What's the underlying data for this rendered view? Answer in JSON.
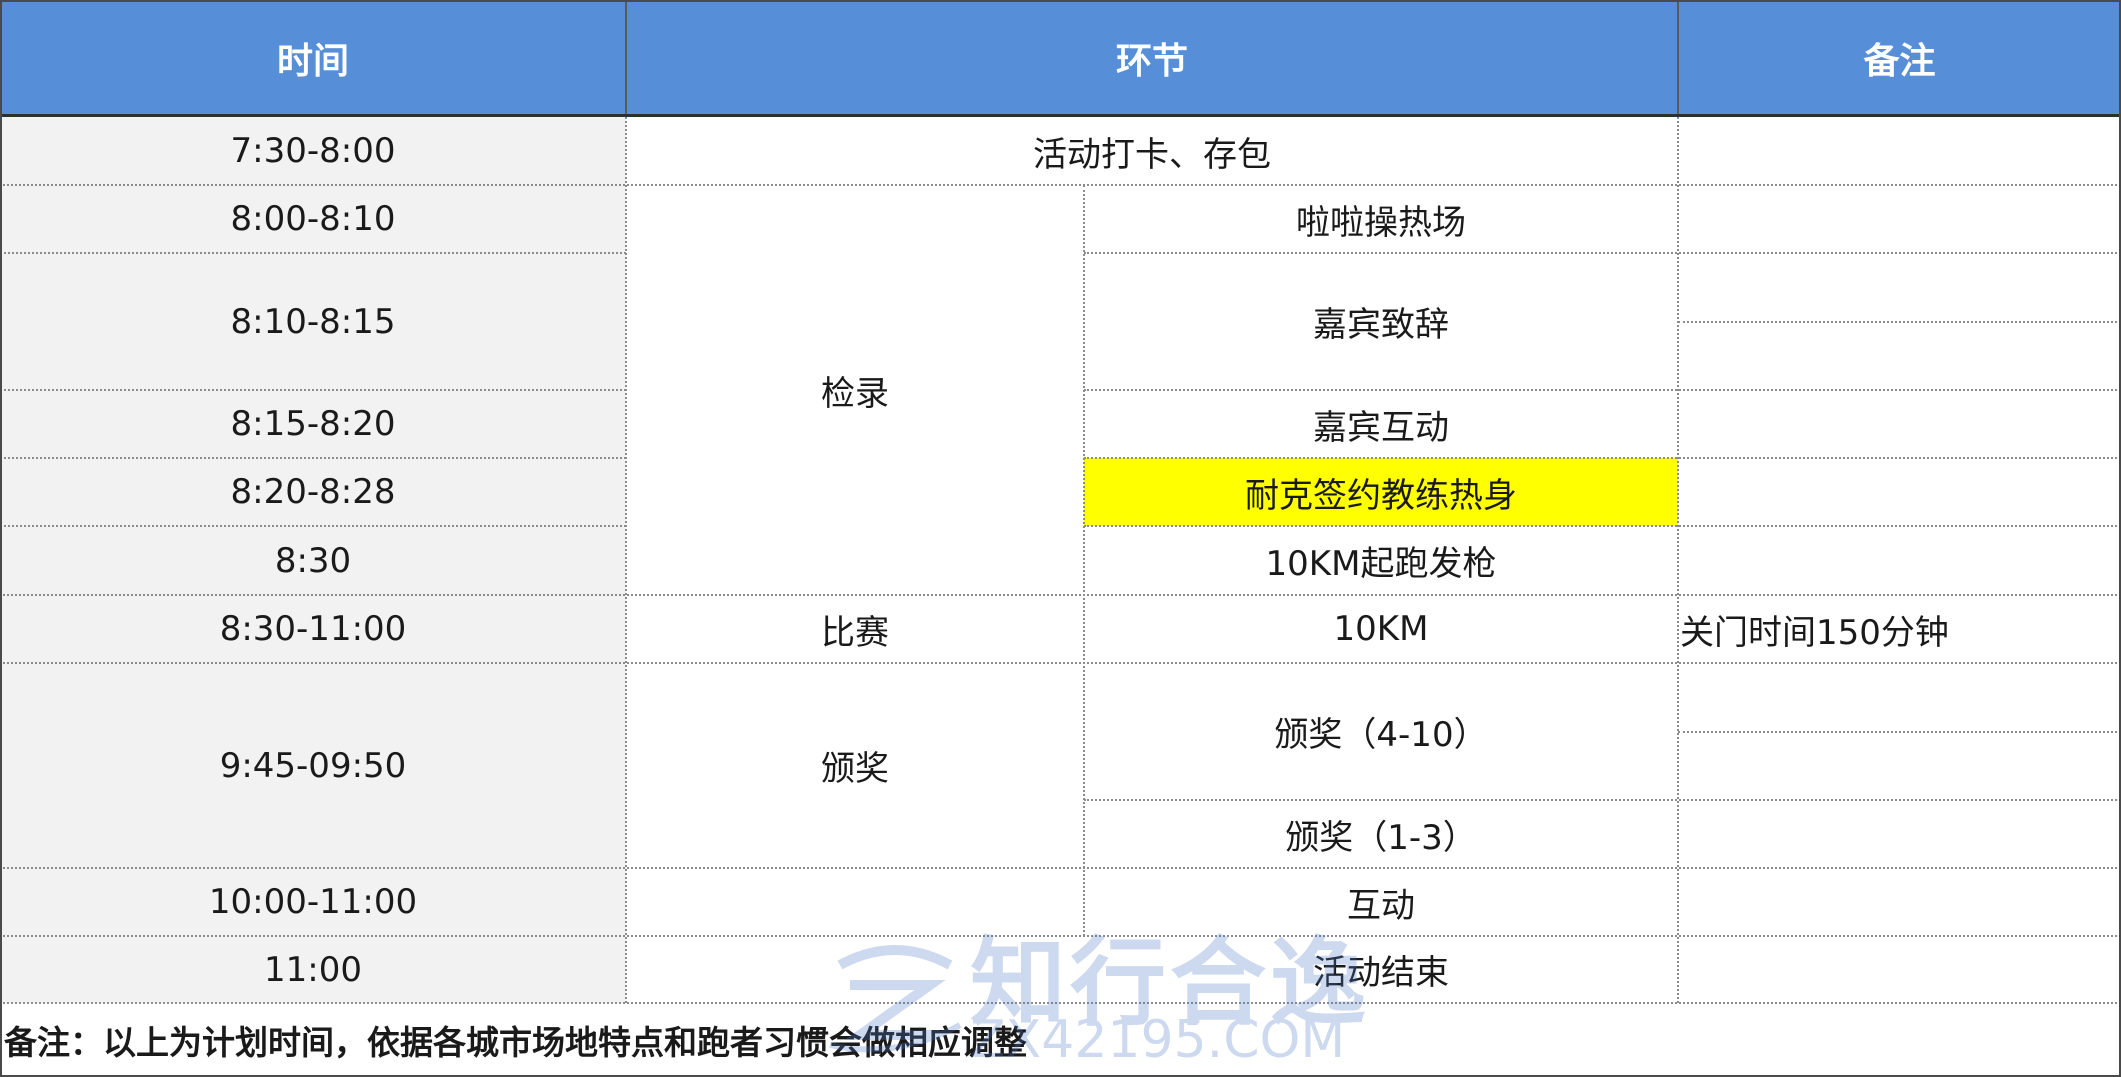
{
  "headers": {
    "time": "时间",
    "segment": "环节",
    "note": "备注"
  },
  "times": [
    "7:30-8:00",
    "8:00-8:10",
    "8:10-8:15",
    "8:15-8:20",
    "8:20-8:28",
    "8:30",
    "8:30-11:00",
    "9:45-09:50",
    "10:00-11:00",
    "11:00"
  ],
  "main_segments": {
    "checkin_activity": "活动打卡、存包",
    "registration": "检录",
    "race": "比赛",
    "awards": "颁奖",
    "end": "活动结束"
  },
  "sub_segments": {
    "cheer_warmup": "啦啦操热场",
    "guest_speech": "嘉宾致辞",
    "guest_interaction": "嘉宾互动",
    "nike_warmup": "耐克签约教练热身",
    "start_gun": "10KM起跑发枪",
    "race_10km": "10KM",
    "awards_4_10": "颁奖（4-10）",
    "awards_1_3": "颁奖（1-3）",
    "interaction": "互动"
  },
  "notes": {
    "cutoff": "关门时间150分钟"
  },
  "footer_note": "备注：以上为计划时间，依据各城市场地特点和跑者习惯会做相应调整",
  "watermark": {
    "text": "知行合逸",
    "url": "ZX42195.COM"
  },
  "colors": {
    "header_bg": "#568fd8",
    "time_bg": "#f2f2f2",
    "highlight": "#ffff00"
  }
}
